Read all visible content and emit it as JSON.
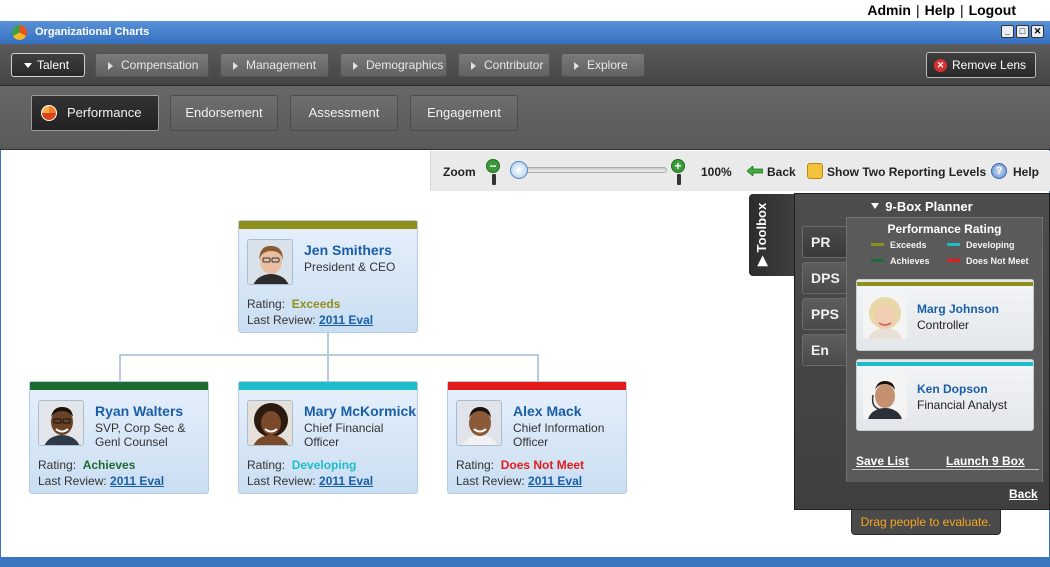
{
  "toplinks": {
    "admin": "Admin",
    "help": "Help",
    "logout": "Logout",
    "sep": "|"
  },
  "window": {
    "title": "Organizational Charts",
    "btn_min": "_",
    "btn_max": "□",
    "btn_close": "✕"
  },
  "lenses": {
    "items": [
      "Talent",
      "Compensation",
      "Management",
      "Demographics",
      "Contributor",
      "Explore"
    ],
    "active": "Talent",
    "remove_label": "Remove Lens"
  },
  "subtabs": {
    "items": [
      "Performance",
      "Endorsement",
      "Assessment",
      "Engagement"
    ],
    "active": "Performance"
  },
  "zoom": {
    "label": "Zoom",
    "minus": "−",
    "plus": "+",
    "level_percent": 100,
    "level_text": "100%",
    "back": "Back",
    "two_levels": "Show Two Reporting Levels",
    "help": "Help"
  },
  "colors": {
    "exceeds": "#8f8f1c",
    "achieves": "#1e6b32",
    "developing": "#1cbcc8",
    "does_not_meet": "#e51b1b",
    "link": "#1a5ea8"
  },
  "org": {
    "root": {
      "name": "Jen Smithers",
      "role": "President & CEO",
      "rating_label": "Rating:",
      "rating": "Exceeds",
      "rating_color": "#8f8f1c",
      "review_label": "Last Review:",
      "review": "2011 Eval"
    },
    "reports": [
      {
        "name": "Ryan Walters",
        "role": "SVP, Corp Sec & Genl Counsel",
        "rating_label": "Rating:",
        "rating": "Achieves",
        "rating_color": "#1e6b32",
        "review_label": "Last Review:",
        "review": "2011 Eval"
      },
      {
        "name": "Mary McKormick",
        "role": "Chief Financial Officer",
        "rating_label": "Rating:",
        "rating": "Developing",
        "rating_color": "#1cbcc8",
        "review_label": "Last Review:",
        "review": "2011 Eval"
      },
      {
        "name": "Alex Mack",
        "role": "Chief Information Officer",
        "rating_label": "Rating:",
        "rating": "Does Not Meet",
        "rating_color": "#e51b1b",
        "review_label": "Last Review:",
        "review": "2011 Eval"
      }
    ]
  },
  "toolbox": {
    "tab_label": "Toolbox",
    "title": "9-Box Planner",
    "sidetabs": [
      "PR",
      "DPS",
      "PPS",
      "En"
    ],
    "active_sidetab": "PR",
    "panel_title": "Performance Rating",
    "legend": [
      {
        "label": "Exceeds",
        "color": "#8f8f1c"
      },
      {
        "label": "Developing",
        "color": "#1cbcc8"
      },
      {
        "label": "Achieves",
        "color": "#1e6b32"
      },
      {
        "label": "Does Not Meet",
        "color": "#e51b1b"
      }
    ],
    "people": [
      {
        "name": "Marg Johnson",
        "role": "Controller",
        "color": "#8f8f1c"
      },
      {
        "name": "Ken Dopson",
        "role": "Financial Analyst",
        "color": "#1cbcc8"
      }
    ],
    "save_list": "Save List",
    "launch": "Launch 9 Box",
    "back": "Back",
    "tip": "Drag people to evaluate."
  }
}
